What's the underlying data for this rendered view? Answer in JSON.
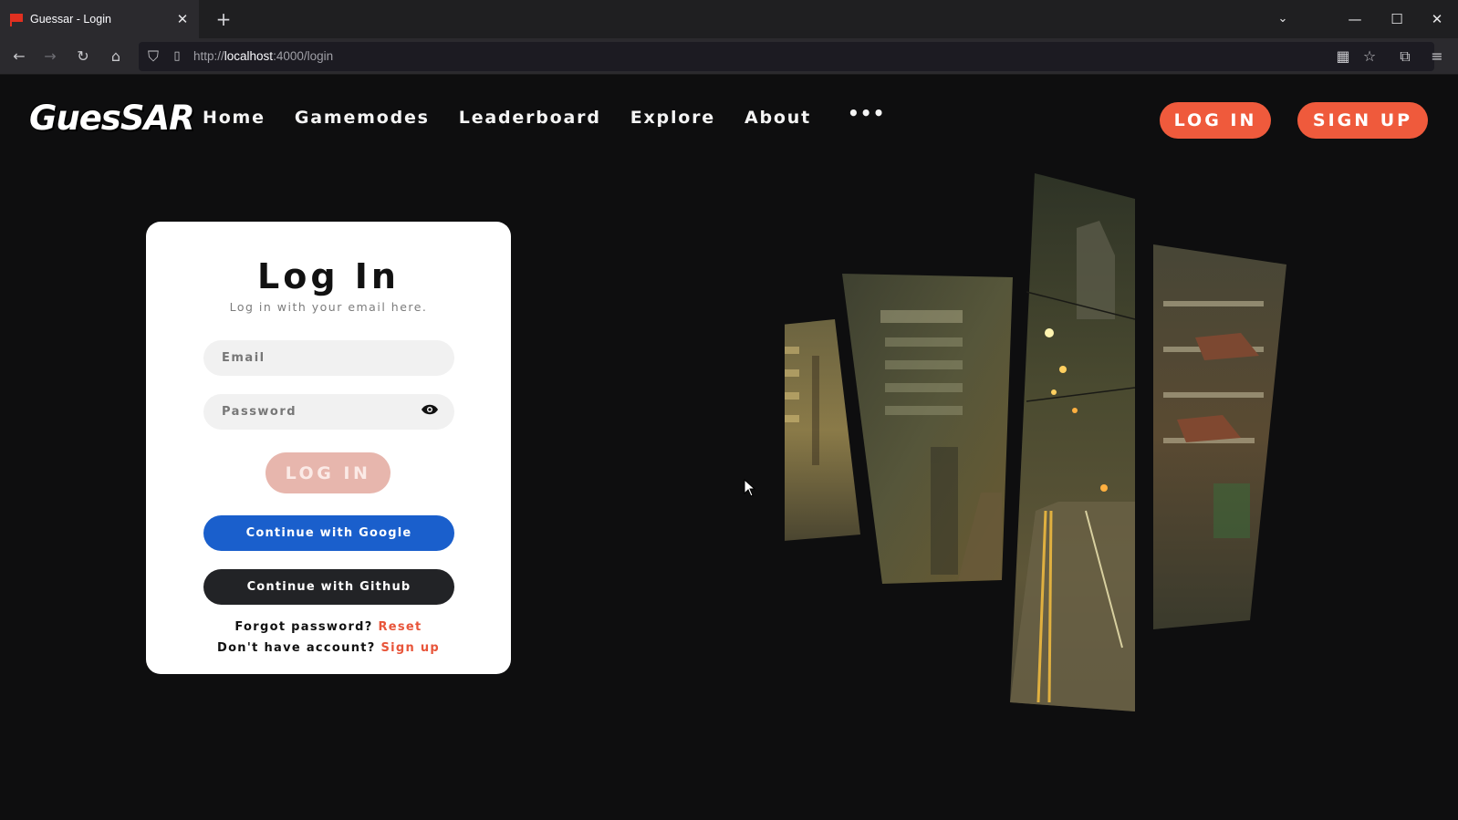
{
  "browser": {
    "tab_title": "Guessar - Login",
    "url_scheme": "http://",
    "url_host": "localhost",
    "url_path": ":4000/login"
  },
  "header": {
    "logo_text": "GuesSAR",
    "menu": [
      "Home",
      "Gamemodes",
      "Leaderboard",
      "Explore",
      "About"
    ],
    "more": "•••",
    "login_label": "LOG IN",
    "signup_label": "SIGN UP"
  },
  "login": {
    "title": "Log In",
    "subtitle": "Log in with your email here.",
    "email_placeholder": "Email",
    "password_placeholder": "Password",
    "submit_label": "LOG IN",
    "google_label": "Continue with Google",
    "github_label": "Continue with Github",
    "forgot_text": "Forgot password?",
    "reset_link": "Reset",
    "no_account_text": "Don't have account?",
    "signup_link": "Sign up"
  },
  "colors": {
    "accent": "#ef5a3c",
    "google": "#1a5fcc",
    "github": "#222326",
    "background": "#0e0e0f"
  }
}
